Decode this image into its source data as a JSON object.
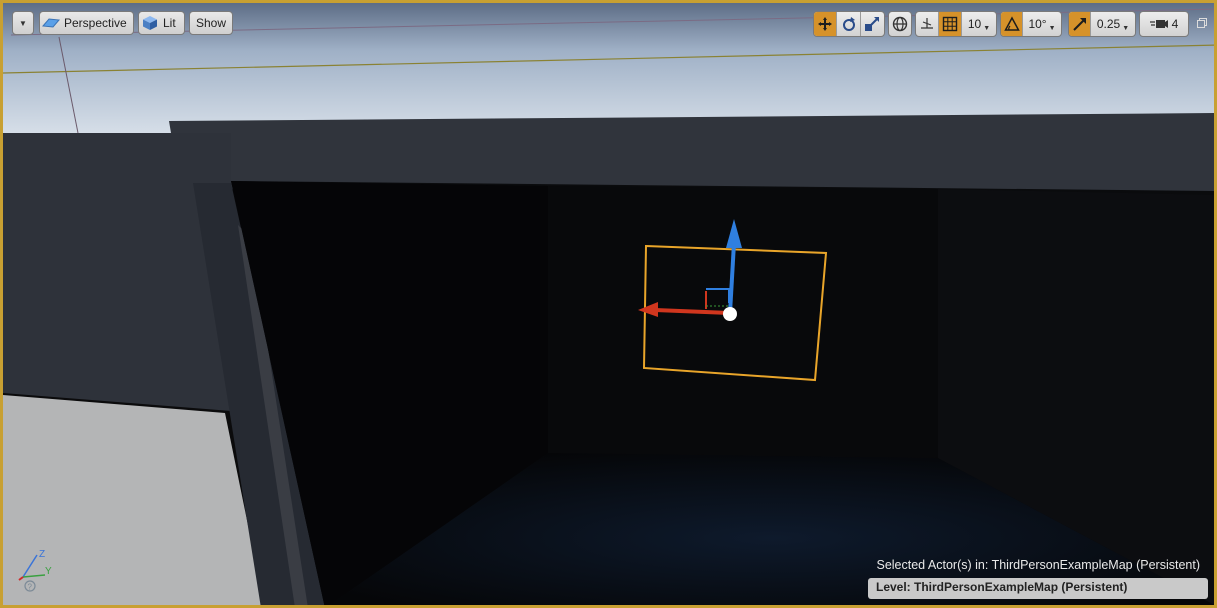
{
  "toolbar": {
    "dropdown_icon": "chevron-down-icon",
    "perspective_label": "Perspective",
    "lit_label": "Lit",
    "show_label": "Show"
  },
  "transform": {
    "grid_snap_value": "10",
    "rotation_snap_value": "10°",
    "scale_snap_value": "0.25",
    "camera_speed_value": "4",
    "active_color": "#d6922a"
  },
  "status": {
    "selected_actors_text": "Selected Actor(s) in:  ThirdPersonExampleMap (Persistent)",
    "level_text": "Level:  ThirdPersonExampleMap (Persistent)"
  },
  "axis_indicator": {
    "z_label": "Z",
    "y_label": "Y"
  },
  "colors": {
    "viewport_border": "#c8a032",
    "gizmo_up": "#2f7fe0",
    "gizmo_left": "#d0361e",
    "selection_box": "#e9a52a"
  }
}
